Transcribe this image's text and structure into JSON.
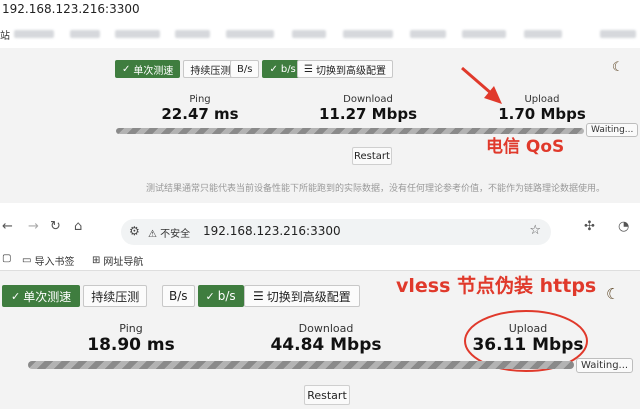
{
  "top": {
    "url": "192.168.123.216:3300",
    "bookmark_first": "站",
    "mode_single": "单次测速",
    "mode_continuous": "持续压测",
    "unit_bytes": "B/s",
    "unit_bits": "b/s",
    "advanced": "切换到高级配置",
    "ping_label": "Ping",
    "ping_value": "22.47 ms",
    "download_label": "Download",
    "download_value": "11.27 Mbps",
    "upload_label": "Upload",
    "upload_value": "1.70 Mbps",
    "progress": 1.0,
    "waiting": "Waiting...",
    "restart": "Restart",
    "note": "测试结果通常只能代表当前设备性能下所能跑到的实际数据，没有任何理论参考价值，不能作为链路理论数据使用。",
    "annotation": "电信 QoS"
  },
  "bottom": {
    "security": "不安全",
    "url": "192.168.123.216:3300",
    "bookmarks": [
      "导入书签",
      "网址导航"
    ],
    "mode_single": "单次测速",
    "mode_continuous": "持续压测",
    "unit_bytes": "B/s",
    "unit_bits": "b/s",
    "advanced": "切换到高级配置",
    "ping_label": "Ping",
    "ping_value": "18.90 ms",
    "download_label": "Download",
    "download_value": "44.84 Mbps",
    "upload_label": "Upload",
    "upload_value": "36.11 Mbps",
    "progress": 1.0,
    "waiting": "Waiting...",
    "restart": "Restart",
    "annotation": "vless 节点伪装 https"
  },
  "colors": {
    "accent_green": "#3f7d3f",
    "annotation_red": "#e0392b"
  }
}
